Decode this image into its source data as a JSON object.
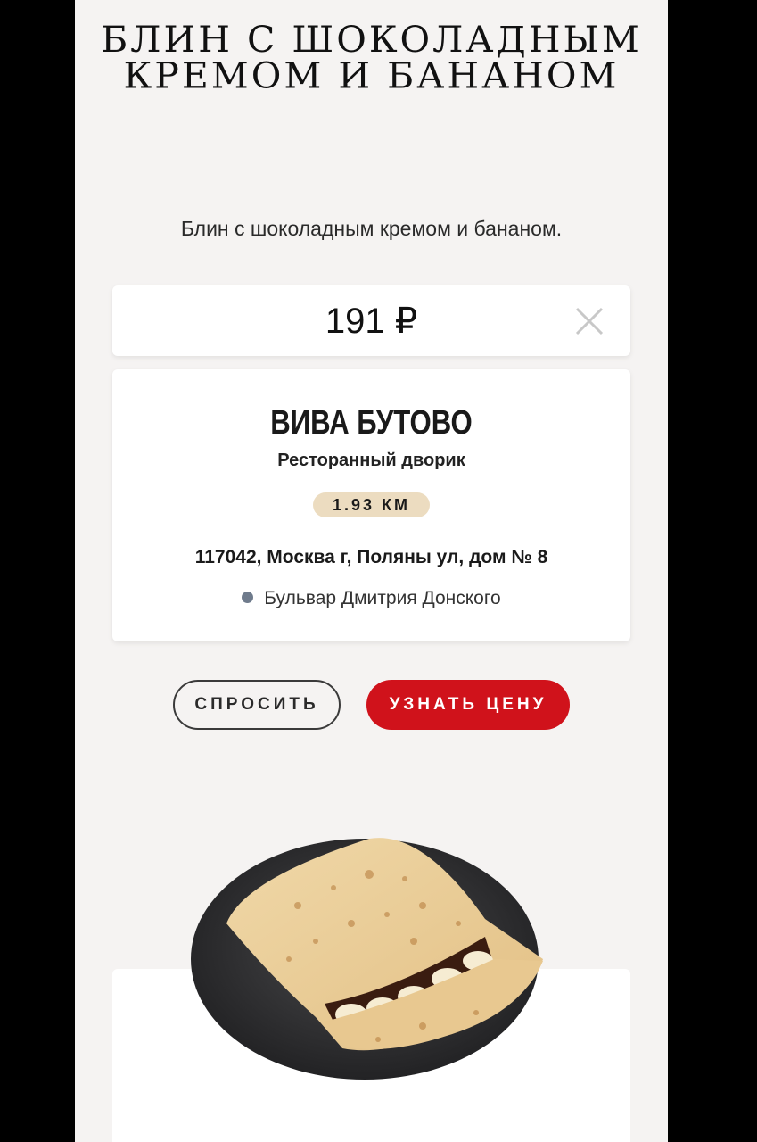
{
  "product": {
    "title": "БЛИН С ШОКОЛАДНЫМ КРЕМОМ И БАНАНОМ",
    "description": "Блин с шоколадным кремом и бананом.",
    "price": "191 ₽"
  },
  "store": {
    "name": "ВИВА БУТОВО",
    "type": "Ресторанный дворик",
    "distance": "1.93 КМ",
    "address": "117042, Москва г, Поляны ул, дом № 8",
    "metro": "Бульвар Дмитрия Донского",
    "metro_color": "#6f7b8c"
  },
  "actions": {
    "ask_label": "СПРОСИТЬ",
    "price_label": "УЗНАТЬ ЦЕНУ",
    "accent_color": "#d0121b"
  },
  "icons": {
    "close": "close-icon"
  }
}
